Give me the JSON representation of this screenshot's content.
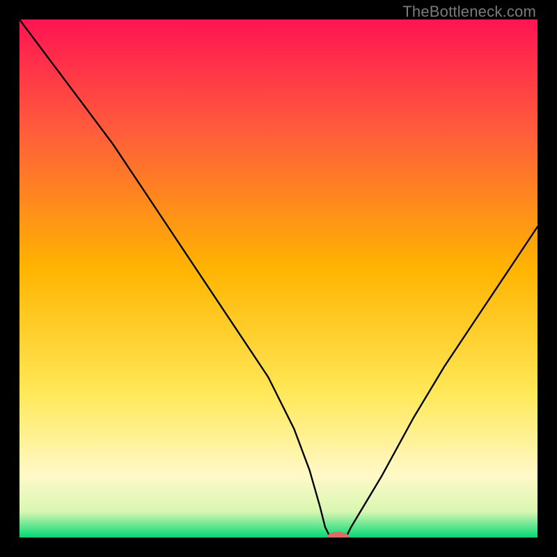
{
  "attribution": "TheBottleneck.com",
  "colors": {
    "bg": "#000000",
    "gradient_top": "#ff1452",
    "gradient_upper": "#ff5e3a",
    "gradient_mid": "#ffb400",
    "gradient_lower": "#ffe857",
    "gradient_pale": "#fff9c8",
    "gradient_green": "#00da74",
    "curve": "#000000",
    "marker": "#e36a63"
  },
  "chart_data": {
    "type": "line",
    "title": "",
    "xlabel": "",
    "ylabel": "",
    "xlim": [
      0,
      100
    ],
    "ylim": [
      0,
      100
    ],
    "legend": false,
    "grid": false,
    "annotations": [],
    "series": [
      {
        "name": "bottleneck-curve",
        "x": [
          0,
          6,
          12,
          18,
          24,
          30,
          36,
          42,
          48,
          53,
          56,
          58,
          59,
          60,
          63,
          64,
          70,
          76,
          82,
          88,
          94,
          100
        ],
        "values": [
          100,
          92,
          84,
          76,
          67,
          58,
          49,
          40,
          31,
          21,
          13,
          6,
          2,
          0,
          0,
          2,
          12,
          23,
          33,
          42,
          51,
          60
        ]
      }
    ],
    "marker": {
      "x": 61.5,
      "y": 0,
      "rx": 2.2,
      "ry": 1.1
    }
  }
}
